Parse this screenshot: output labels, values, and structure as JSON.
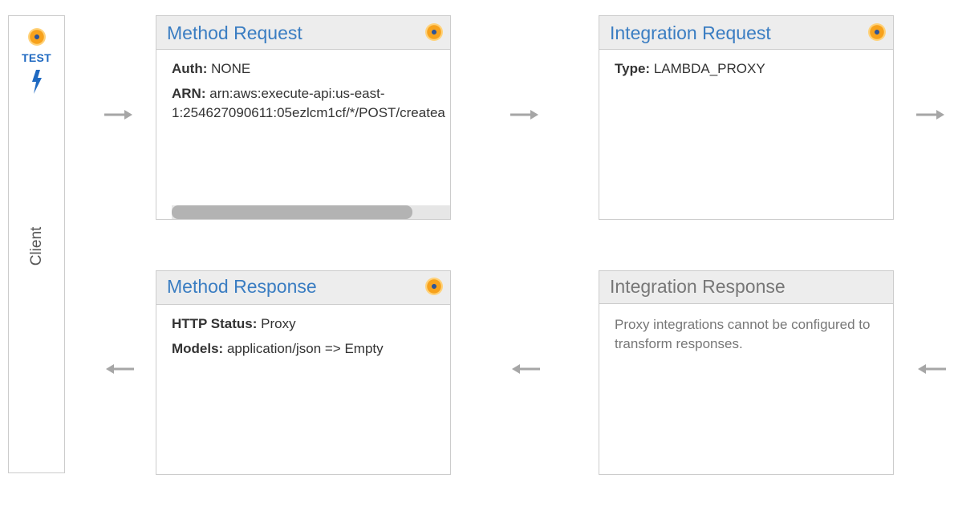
{
  "client": {
    "test_label": "TEST",
    "label": "Client",
    "icons": [
      "orange-dot-icon",
      "lightning-bolt-icon"
    ]
  },
  "method_request": {
    "title": "Method Request",
    "auth_key": "Auth:",
    "auth_value": "NONE",
    "arn_key": "ARN:",
    "arn_line1": "arn:aws:execute-api:us-east-",
    "arn_line2": "1:254627090611:05ezlcm1cf/*/POST/createa"
  },
  "integration_request": {
    "title": "Integration Request",
    "type_key": "Type:",
    "type_value": "LAMBDA_PROXY"
  },
  "method_response": {
    "title": "Method Response",
    "status_key": "HTTP Status:",
    "status_value": "Proxy",
    "models_key": "Models:",
    "models_value": "application/json => Empty"
  },
  "integration_response": {
    "title": "Integration Response",
    "note": "Proxy integrations cannot be configured to transform responses."
  },
  "colors": {
    "link_blue": "#3a7dc2",
    "test_blue": "#1f69c1",
    "dot_orange": "#f7a21c",
    "arrow_gray": "#a6a6a6",
    "header_bg": "#ededed"
  }
}
